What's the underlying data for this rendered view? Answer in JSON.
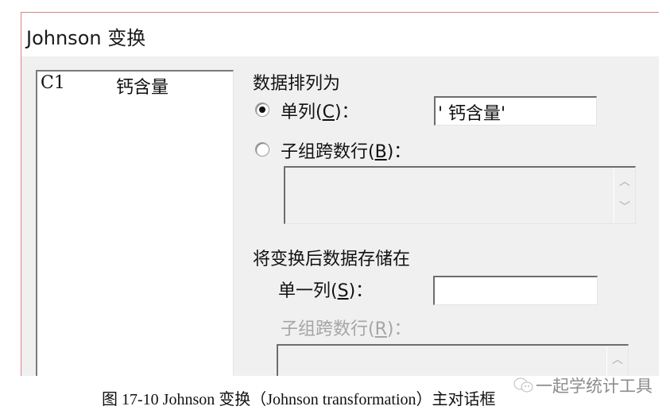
{
  "dialog": {
    "title": "Johnson 变换",
    "variables": [
      {
        "col": "C1",
        "name": "钙含量"
      }
    ],
    "data_arrangement": {
      "heading": "数据排列为",
      "single_column": {
        "label_pre": "单列(",
        "mnemonic": "C",
        "label_post": ")：",
        "selected": true,
        "value": "' 钙含量'"
      },
      "subgroups_across_rows": {
        "label_pre": "子组跨数行(",
        "mnemonic": "B",
        "label_post": ")：",
        "selected": false,
        "value": ""
      }
    },
    "store": {
      "heading": "将变换后数据存储在",
      "single_column": {
        "label_pre": "单一列(",
        "mnemonic": "S",
        "label_post": ")：",
        "value": ""
      },
      "subgroups_across_rows": {
        "label_pre": "子组跨数行(",
        "mnemonic": "R",
        "label_post": ")：",
        "enabled": false,
        "value": ""
      }
    },
    "scroll_icons": {
      "up": "chevron-up-icon",
      "down": "chevron-down-icon"
    }
  },
  "caption": "图 17-10  Johnson 变换（Johnson transformation）主对话框",
  "watermark": "一起学统计工具"
}
